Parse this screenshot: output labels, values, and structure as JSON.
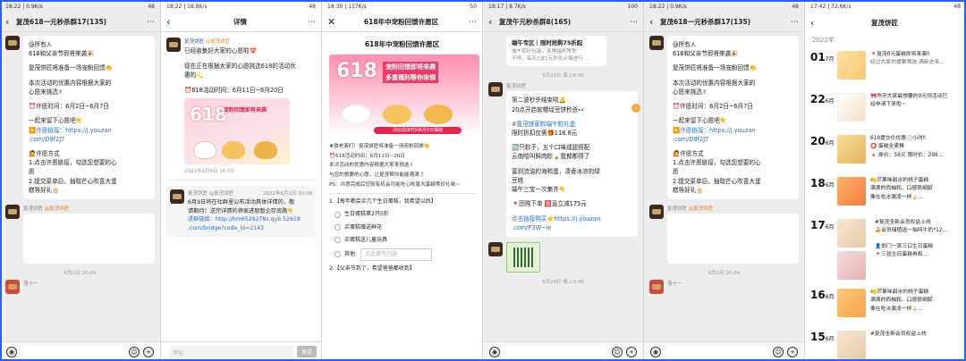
{
  "panel1": {
    "status": {
      "left": "18:22 | 0.9K/s",
      "right": "48"
    },
    "title": "复茂618一元秒杀群17(135)",
    "sender": "复茂饼匠",
    "sender_tag": "@复茂饼匠",
    "messages": [
      "@所有人",
      "618和父亲节即将来袭🎉",
      "复茂饼匠将准备一场宠粉回馈👏",
      "本次活动的优惠内容根据大家的",
      "心愿来挑选✌",
      "⏰许愿时间：6月2日~6月7日",
      "一起来留下心愿吧👇",
      "▶️许愿链接：https://j.youzan",
      ".com/D9f2J7",
      "🙋许愿方式",
      "1.点击许愿链接，勾选您想要的心",
      "愿",
      "2.提交菜单后，抽取芒心吹喜大蛋",
      "糕等好礼🎂"
    ],
    "sender2": "复茂饼匠 @复茂饼匠",
    "time2": "6月2日 20:04",
    "sender3": "落十一"
  },
  "panel2": {
    "status": {
      "left": "18:22 | 18.8K/s",
      "right": "48"
    },
    "title": "详情",
    "sender": "复茂饼匠",
    "sender_tag": "@复茂饼匠",
    "messages": [
      "已经收集好大家的心愿啦💝",
      "现在正在根据大家的心愿挑选618的活动优",
      "惠的💫",
      "⏰618活动时间：6月11日~6月20日"
    ],
    "poster_big": "618",
    "poster_line": "宠粉回馈即将来袭",
    "image_time": "2022年6月9日 16:00",
    "comment_sender": "复茂饼匠 @复茂饼匠",
    "comment_time": "2022年6月1日 20:09",
    "comment_lines": [
      "6月9日将在社群里公布活动具体详情的，敬",
      "请期待！送完详情的将家进朋暂企存底路👇",
      "进群链接：http://hm6529278z.qyb.52618",
      ".com/bridge?code_id=2143"
    ],
    "input_placeholder": "评论",
    "send_label": "发送"
  },
  "panel3": {
    "status": {
      "left": "18:30 | 117K/s",
      "right": "50"
    },
    "title": "618年中宠粉回馈许愿区",
    "page_title": "618年中宠粉回馈许愿区",
    "banner_big": "618",
    "banner_h1": "宠粉回馈即将来袭",
    "banner_h2": "多重福利等你来领",
    "banner_bar": "活动具体时间6月9日揭晓",
    "text_lines": [
      "❖致老客们！复茂饼匠将准备一场宠粉回馈👏",
      "⏰618活动时间：6月11日~20日",
      "本次活动的优惠内容根据大家来挑选✌",
      "与您的想要的心愿，让复茂帮你能能满满❗",
      "PS：许愿完成后您就有机会可能吃心吹喜大蛋糕等好礼呦~"
    ],
    "q1": "1.【每年都会买几个生日蛋糕，我希望以后】",
    "options": [
      "生日蛋糕第2只5折",
      "买蛋糕赠送鲜花",
      "买蛋糕送儿童玩具",
      "其他"
    ],
    "other_placeholder": "点此填写内容",
    "q2": "2.【父亲节到了，希望爸爸都收到】"
  },
  "panel4": {
    "status": {
      "left": "18:17 | 8.7K/s",
      "right": "100"
    },
    "title": "复茂午元秒杀群8(165)",
    "top_lines": [
      "端午专区｜限时抢购75折起",
      "端午粽叶包装，各种福利等你",
      "不停，每天2波1元秒杀火爆进行..."
    ],
    "time1": "5月29日 晚上8:00",
    "sender": "复茂饼匠",
    "lines": [
      "第二波秒杀结束啦🔔",
      "20点开启软糯绿豆饼秒杀👀",
      "#复茂饼家粽端午粽礼盒",
      "限时折扣仅需🎁118.8元",
      "🆗只粽子，五个口味咸甜搭配",
      "云南哈叫鲜肉粽🍃我都都得了",
      "富到流油的海鸭蛋，清香冰凉的绿",
      "豆统",
      "端午三宝一次集齐👇",
      "🔻团购下单 🈴直立减175元",
      "点击链接购买👉https://j.youzan",
      ".com/P3W~ie"
    ],
    "time2": "5月29日 晚上9:40"
  },
  "panel5": {
    "status": {
      "left": "18:22 | 0.9K/s",
      "right": "48"
    },
    "title": "复茂618一元秒杀群17(135)",
    "sender": "复茂饼匠",
    "sender_tag": "@复茂饼匠",
    "messages": [
      "@所有人",
      "618和父亲节即将来袭🎉",
      "复茂饼匠将准备一场宠粉回馈👏",
      "本次活动的优惠内容根据大家的",
      "心愿来挑选✌",
      "⏰许愿时间：6月2日~6月7日",
      "一起来留下心愿吧👇",
      "▶️许愿链接：https://j.youzan",
      ".com/D9f2J7",
      "🙋许愿方式",
      "1.点击许愿链接，勾选您想要的心",
      "愿",
      "2.提交菜单后，抽取芒心吹喜大蛋",
      "糕等好礼🎂"
    ],
    "time2": "6月2日 20:04",
    "sender3": "落十一"
  },
  "panel6": {
    "status": {
      "left": "17:42 | 72.6K/s",
      "right": "48"
    },
    "title": "复茂饼匠",
    "year": "2022年",
    "rows": [
      {
        "day": "01",
        "month": "7月",
        "lines": [
          "🔻复茂0元蛋糕即将来袭‼",
          "经过大家的提案筛选 满新史来..."
        ]
      },
      {
        "day": "22",
        "month": "6月",
        "lines": [
          "🎀昨天大家最想要的0元领活动已",
          "经申请下来啦~"
        ]
      },
      {
        "day": "20",
        "month": "6月",
        "lines": [
          "618提交价优惠🕐小时‼",
          "⭕ 蛋糕全麦棒",
          "🔺 原价：58元 限时价：298..."
        ]
      },
      {
        "day": "18",
        "month": "6月",
        "lines": [
          "🍋芒果味甜冰的桃子蛋糕",
          "满满的西柚和、口感很细腻",
          "像在吃冰激凌一样🍦..."
        ]
      },
      {
        "day": "17",
        "month": "6月",
        "lines": [
          "#复茂全新会员权益上线",
          "🍰会员储值送一抽持牛奶*12...",
          "👤即门一家三口生日蛋糕",
          "🔻三张生日蛋糕券和..."
        ]
      },
      {
        "day": "16",
        "month": "6月",
        "lines": [
          "🍋芒果味甜冰的桃子蛋糕",
          "满满的西柚和、口感很细腻",
          "像在吃冰激凌一样🍦..."
        ]
      },
      {
        "day": "15",
        "month": "6月",
        "lines": [
          "#复茂全新会员权益上线"
        ]
      }
    ]
  },
  "colors": {
    "accent": "#e8832b",
    "link": "#2b6cc4",
    "frame": "#2563eb"
  }
}
